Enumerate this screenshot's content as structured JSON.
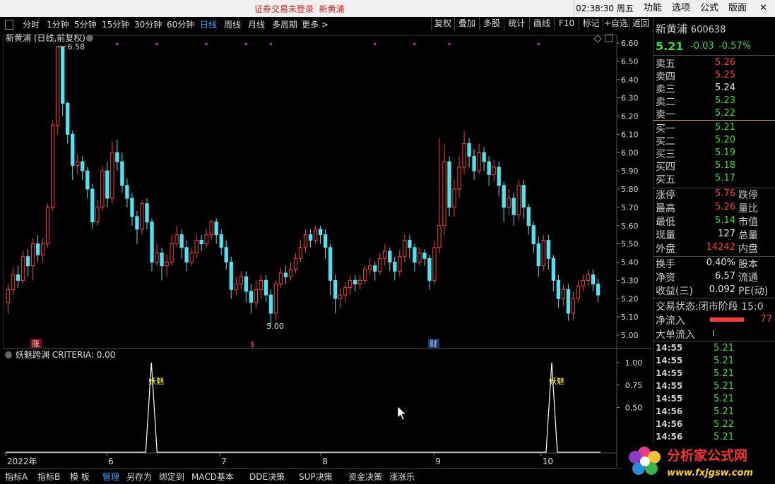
{
  "titlebar": {
    "notice": "证券交易未登录",
    "stock": "新黄浦",
    "clock": "02:38:30 周五",
    "menu": [
      "功能",
      "选项",
      "公式",
      "版面"
    ],
    "close": "✕"
  },
  "toolbar": {
    "periods": [
      "分时",
      "1分钟",
      "5分钟",
      "15分钟",
      "30分钟",
      "60分钟",
      "日线",
      "周线",
      "月线",
      "多周期",
      "更多 >"
    ],
    "active_period": "日线",
    "actions": [
      "复权",
      "叠加",
      "多股",
      "统计",
      "画线",
      "F10",
      "标记",
      "+自选",
      "返回"
    ]
  },
  "main_chart": {
    "title": "新黄浦 (日线,前复权)",
    "high_label": "6.58",
    "low_label": "5.00",
    "price_axis": [
      "6.60",
      "6.50",
      "6.40",
      "6.30",
      "6.20",
      "6.10",
      "6.00",
      "5.90",
      "5.80",
      "5.70",
      "5.60",
      "5.50",
      "5.40",
      "5.30",
      "5.20",
      "5.10",
      "5.00"
    ],
    "markers": [
      "涨",
      "$",
      "财"
    ],
    "up_color": "#ff3b3b",
    "down_color": "#4fe3ef"
  },
  "chart_data": {
    "type": "candlestick",
    "ylim": [
      5.0,
      6.6
    ],
    "candles": [
      [
        5.18,
        5.25,
        5.12,
        5.28
      ],
      [
        5.25,
        5.33,
        5.22,
        5.37
      ],
      [
        5.33,
        5.3,
        5.26,
        5.38
      ],
      [
        5.3,
        5.43,
        5.28,
        5.46
      ],
      [
        5.43,
        5.38,
        5.32,
        5.47
      ],
      [
        5.38,
        5.5,
        5.3,
        5.53
      ],
      [
        5.5,
        5.44,
        5.4,
        5.55
      ],
      [
        5.44,
        5.5,
        5.4,
        5.53
      ],
      [
        5.5,
        5.7,
        5.48,
        5.72
      ],
      [
        5.7,
        6.15,
        5.68,
        6.18
      ],
      [
        6.15,
        6.58,
        6.1,
        6.58
      ],
      [
        6.58,
        6.27,
        6.2,
        6.58
      ],
      [
        6.27,
        6.1,
        6.05,
        6.28
      ],
      [
        6.1,
        5.93,
        5.85,
        6.12
      ],
      [
        5.93,
        5.95,
        5.88,
        5.99
      ],
      [
        5.95,
        5.9,
        5.85,
        5.98
      ],
      [
        5.9,
        5.8,
        5.75,
        5.92
      ],
      [
        5.8,
        5.62,
        5.58,
        5.83
      ],
      [
        5.62,
        5.7,
        5.6,
        5.74
      ],
      [
        5.7,
        5.9,
        5.68,
        5.93
      ],
      [
        5.9,
        5.75,
        5.7,
        5.95
      ],
      [
        5.75,
        6.0,
        5.72,
        6.06
      ],
      [
        6.0,
        5.95,
        5.9,
        6.07
      ],
      [
        5.95,
        5.82,
        5.78,
        6.0
      ],
      [
        5.82,
        5.75,
        5.7,
        5.86
      ],
      [
        5.75,
        5.65,
        5.6,
        5.78
      ],
      [
        5.65,
        5.58,
        5.5,
        5.68
      ],
      [
        5.58,
        5.72,
        5.55,
        5.74
      ],
      [
        5.72,
        5.62,
        5.58,
        5.75
      ],
      [
        5.62,
        5.4,
        5.35,
        5.64
      ],
      [
        5.4,
        5.45,
        5.38,
        5.5
      ],
      [
        5.45,
        5.38,
        5.3,
        5.48
      ],
      [
        5.38,
        5.4,
        5.32,
        5.44
      ],
      [
        5.4,
        5.5,
        5.38,
        5.55
      ],
      [
        5.5,
        5.55,
        5.48,
        5.6
      ],
      [
        5.55,
        5.48,
        5.42,
        5.58
      ],
      [
        5.48,
        5.4,
        5.35,
        5.52
      ],
      [
        5.4,
        5.45,
        5.38,
        5.48
      ],
      [
        5.45,
        5.52,
        5.42,
        5.55
      ],
      [
        5.52,
        5.5,
        5.46,
        5.55
      ],
      [
        5.5,
        5.55,
        5.48,
        5.58
      ],
      [
        5.55,
        5.62,
        5.52,
        5.63
      ],
      [
        5.62,
        5.55,
        5.5,
        5.64
      ],
      [
        5.55,
        5.48,
        5.44,
        5.58
      ],
      [
        5.48,
        5.4,
        5.36,
        5.52
      ],
      [
        5.4,
        5.25,
        5.2,
        5.43
      ],
      [
        5.25,
        5.28,
        5.22,
        5.32
      ],
      [
        5.28,
        5.32,
        5.25,
        5.35
      ],
      [
        5.32,
        5.24,
        5.18,
        5.35
      ],
      [
        5.24,
        5.18,
        5.12,
        5.28
      ],
      [
        5.18,
        5.25,
        5.15,
        5.3
      ],
      [
        5.25,
        5.3,
        5.2,
        5.33
      ],
      [
        5.3,
        5.22,
        5.18,
        5.33
      ],
      [
        5.22,
        5.12,
        5.05,
        5.25
      ],
      [
        5.12,
        5.28,
        5.08,
        5.3
      ],
      [
        5.28,
        5.34,
        5.26,
        5.37
      ],
      [
        5.34,
        5.32,
        5.28,
        5.38
      ],
      [
        5.32,
        5.36,
        5.3,
        5.4
      ],
      [
        5.36,
        5.42,
        5.34,
        5.45
      ],
      [
        5.42,
        5.48,
        5.4,
        5.52
      ],
      [
        5.48,
        5.55,
        5.45,
        5.58
      ],
      [
        5.55,
        5.52,
        5.48,
        5.58
      ],
      [
        5.52,
        5.58,
        5.5,
        5.6
      ],
      [
        5.58,
        5.55,
        5.5,
        5.6
      ],
      [
        5.55,
        5.48,
        5.42,
        5.58
      ],
      [
        5.48,
        5.3,
        5.22,
        5.5
      ],
      [
        5.3,
        5.2,
        5.12,
        5.33
      ],
      [
        5.2,
        5.22,
        5.15,
        5.26
      ],
      [
        5.22,
        5.26,
        5.18,
        5.29
      ],
      [
        5.26,
        5.3,
        5.22,
        5.33
      ],
      [
        5.3,
        5.28,
        5.24,
        5.33
      ],
      [
        5.28,
        5.3,
        5.25,
        5.33
      ],
      [
        5.3,
        5.36,
        5.28,
        5.38
      ],
      [
        5.36,
        5.38,
        5.33,
        5.42
      ],
      [
        5.38,
        5.35,
        5.3,
        5.4
      ],
      [
        5.35,
        5.42,
        5.33,
        5.45
      ],
      [
        5.42,
        5.46,
        5.38,
        5.5
      ],
      [
        5.46,
        5.4,
        5.35,
        5.48
      ],
      [
        5.4,
        5.35,
        5.3,
        5.43
      ],
      [
        5.35,
        5.43,
        5.32,
        5.47
      ],
      [
        5.43,
        5.52,
        5.4,
        5.55
      ],
      [
        5.52,
        5.48,
        5.42,
        5.55
      ],
      [
        5.48,
        5.4,
        5.35,
        5.5
      ],
      [
        5.4,
        5.45,
        5.38,
        5.48
      ],
      [
        5.45,
        5.42,
        5.38,
        5.47
      ],
      [
        5.42,
        5.3,
        5.25,
        5.44
      ],
      [
        5.3,
        5.48,
        5.28,
        5.52
      ],
      [
        5.48,
        5.6,
        5.45,
        6.08
      ],
      [
        5.6,
        5.95,
        5.55,
        6.05
      ],
      [
        5.95,
        5.7,
        5.65,
        5.98
      ],
      [
        5.7,
        5.8,
        5.65,
        5.85
      ],
      [
        5.8,
        5.92,
        5.75,
        5.98
      ],
      [
        5.92,
        6.05,
        5.88,
        6.12
      ],
      [
        6.05,
        5.98,
        5.92,
        6.08
      ],
      [
        5.98,
        5.9,
        5.85,
        6.02
      ],
      [
        5.9,
        6.0,
        5.88,
        6.05
      ],
      [
        6.0,
        5.95,
        5.9,
        6.03
      ],
      [
        5.95,
        5.88,
        5.82,
        5.98
      ],
      [
        5.88,
        5.92,
        5.84,
        5.96
      ],
      [
        5.92,
        5.82,
        5.76,
        5.95
      ],
      [
        5.82,
        5.7,
        5.62,
        5.84
      ],
      [
        5.7,
        5.75,
        5.66,
        5.8
      ],
      [
        5.75,
        5.66,
        5.6,
        5.78
      ],
      [
        5.66,
        5.82,
        5.63,
        5.85
      ],
      [
        5.82,
        5.7,
        5.64,
        5.85
      ],
      [
        5.7,
        5.6,
        5.55,
        5.72
      ],
      [
        5.6,
        5.5,
        5.45,
        5.62
      ],
      [
        5.5,
        5.38,
        5.32,
        5.54
      ],
      [
        5.38,
        5.52,
        5.35,
        5.55
      ],
      [
        5.52,
        5.42,
        5.36,
        5.55
      ],
      [
        5.42,
        5.3,
        5.24,
        5.44
      ],
      [
        5.3,
        5.2,
        5.15,
        5.33
      ],
      [
        5.2,
        5.25,
        5.16,
        5.28
      ],
      [
        5.25,
        5.12,
        5.08,
        5.28
      ],
      [
        5.12,
        5.2,
        5.08,
        5.24
      ],
      [
        5.2,
        5.27,
        5.18,
        5.3
      ],
      [
        5.27,
        5.3,
        5.24,
        5.33
      ],
      [
        5.3,
        5.33,
        5.27,
        5.36
      ],
      [
        5.33,
        5.28,
        5.24,
        5.36
      ],
      [
        5.28,
        5.22,
        5.18,
        5.31
      ]
    ]
  },
  "indicator": {
    "title": "妖魅跨渊 CRITERIA: 0.00",
    "signal_label": "妖魅",
    "axis": [
      "1.00",
      "0.75",
      "0.50"
    ],
    "spikes": [
      0.245,
      0.918
    ],
    "x_axis": [
      [
        "2022年",
        0.0
      ],
      [
        "6",
        0.17
      ],
      [
        "7",
        0.36
      ],
      [
        "8",
        0.53
      ],
      [
        "9",
        0.72
      ],
      [
        "10",
        0.9
      ]
    ]
  },
  "panel": {
    "name": "新黄浦",
    "code": "600638",
    "price": "5.21",
    "change": "-0.03",
    "change_pct": "-0.57%",
    "asks": [
      [
        "卖五",
        "5.26",
        "red"
      ],
      [
        "卖四",
        "5.25",
        "red"
      ],
      [
        "卖三",
        "5.24",
        "white"
      ],
      [
        "卖二",
        "5.23",
        "green"
      ],
      [
        "卖一",
        "5.22",
        "green"
      ]
    ],
    "bids": [
      [
        "买一",
        "5.21",
        "green"
      ],
      [
        "买二",
        "5.20",
        "green"
      ],
      [
        "买三",
        "5.19",
        "green"
      ],
      [
        "买四",
        "5.18",
        "green"
      ],
      [
        "买五",
        "5.17",
        "green"
      ]
    ],
    "stats": [
      [
        "涨停",
        "5.76",
        "red",
        "跌停"
      ],
      [
        "最高",
        "5.26",
        "red",
        "量比"
      ],
      [
        "最低",
        "5.14",
        "green",
        "市值"
      ],
      [
        "现量",
        "127",
        "white",
        "总量"
      ],
      [
        "外盘",
        "14242",
        "red",
        "内盘"
      ]
    ],
    "stats2": [
      [
        "换手",
        "0.40%",
        "white",
        "股本"
      ],
      [
        "净资",
        "6.57",
        "white",
        "流通"
      ],
      [
        "收益(三)",
        "0.092",
        "white",
        "PE(动)"
      ]
    ],
    "trade_state_label": "交易状态:",
    "trade_state_value": "闭市阶段 15:0",
    "net_inflow_label": "净流入",
    "net_inflow_value": "77",
    "big_inflow_label": "大单流入",
    "ticks": [
      [
        "14:55",
        "5.21"
      ],
      [
        "14:55",
        "5.21"
      ],
      [
        "14:55",
        "5.21"
      ],
      [
        "14:55",
        "5.21"
      ],
      [
        "14:55",
        "5.21"
      ],
      [
        "14:56",
        "5.21"
      ],
      [
        "14:56",
        "5.22"
      ],
      [
        "14:56",
        "5.21"
      ]
    ]
  },
  "bottom_tabs": [
    "指标A",
    "指标B",
    "模 板",
    "管理",
    "另存为",
    "绑定到",
    "MACD基本",
    "DDE决策",
    "SUP决策",
    "资金决策",
    "涨涨乐"
  ],
  "bottom_selected": "管理",
  "logo": {
    "name": "分析家公式网",
    "url": "www.fxjgsw.com"
  }
}
